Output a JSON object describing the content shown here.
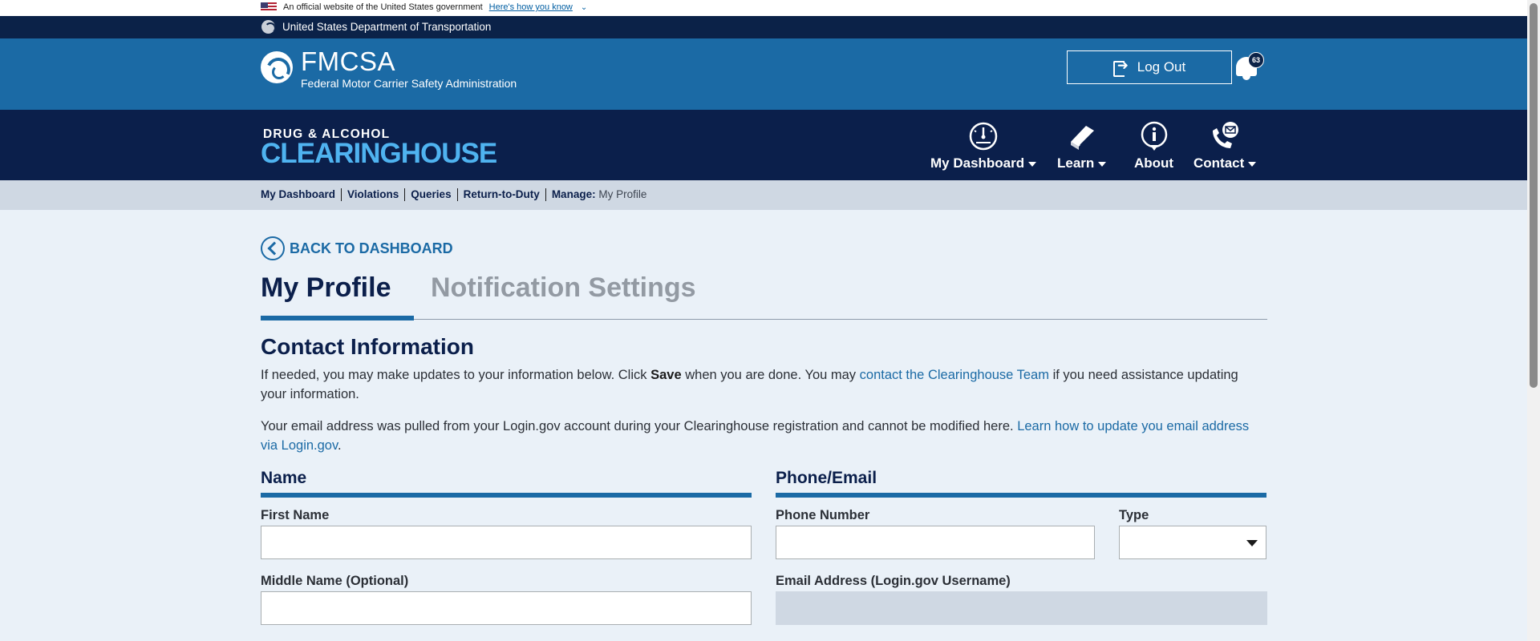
{
  "gov_banner": {
    "text": "An official website of the United States government",
    "link": "Here's how you know"
  },
  "dot_bar": {
    "text": "United States Department of Transportation"
  },
  "fmcsa": {
    "title": "FMCSA",
    "subtitle": "Federal Motor Carrier Safety Administration",
    "logout_label": "Log Out",
    "notification_count": "63"
  },
  "clearinghouse": {
    "top": "DRUG & ALCOHOL",
    "main": "CLEARINGHOUSE",
    "nav": [
      {
        "label": "My Dashboard",
        "icon": "dashboard-gauge-icon",
        "has_dropdown": true
      },
      {
        "label": "Learn",
        "icon": "book-icon",
        "has_dropdown": true
      },
      {
        "label": "About",
        "icon": "info-icon",
        "has_dropdown": false
      },
      {
        "label": "Contact",
        "icon": "phone-email-icon",
        "has_dropdown": true
      }
    ]
  },
  "breadcrumbs": {
    "items": [
      "My Dashboard",
      "Violations",
      "Queries",
      "Return-to-Duty"
    ],
    "manage_label": "Manage:",
    "manage_value": "My Profile"
  },
  "main": {
    "back_label": "BACK TO DASHBOARD",
    "tabs": [
      {
        "label": "My Profile",
        "active": true
      },
      {
        "label": "Notification Settings",
        "active": false
      }
    ],
    "section_title": "Contact Information",
    "para1": {
      "before": "If needed, you may make updates to your information below. Click ",
      "bold": "Save",
      "middle": " when you are done. You may ",
      "link": "contact the Clearinghouse Team",
      "after": " if you need assistance updating your information."
    },
    "para2": {
      "before": "Your email address was pulled from your Login.gov account during your Clearinghouse registration and cannot be modified here. ",
      "link": "Learn how to update you email address via Login.gov",
      "after": "."
    },
    "name_section": {
      "title": "Name",
      "first_name_label": "First Name",
      "first_name_value": "",
      "middle_name_label": "Middle Name (Optional)",
      "middle_name_value": ""
    },
    "phone_section": {
      "title": "Phone/Email",
      "phone_label": "Phone Number",
      "phone_value": "",
      "type_label": "Type",
      "type_value": "",
      "email_label": "Email Address (Login.gov Username)",
      "email_value": ""
    }
  },
  "colors": {
    "navy": "#0b1f4b",
    "blue": "#1b6aa5",
    "light_blue": "#4fb3f0",
    "page_bg": "#eaf1f8"
  }
}
